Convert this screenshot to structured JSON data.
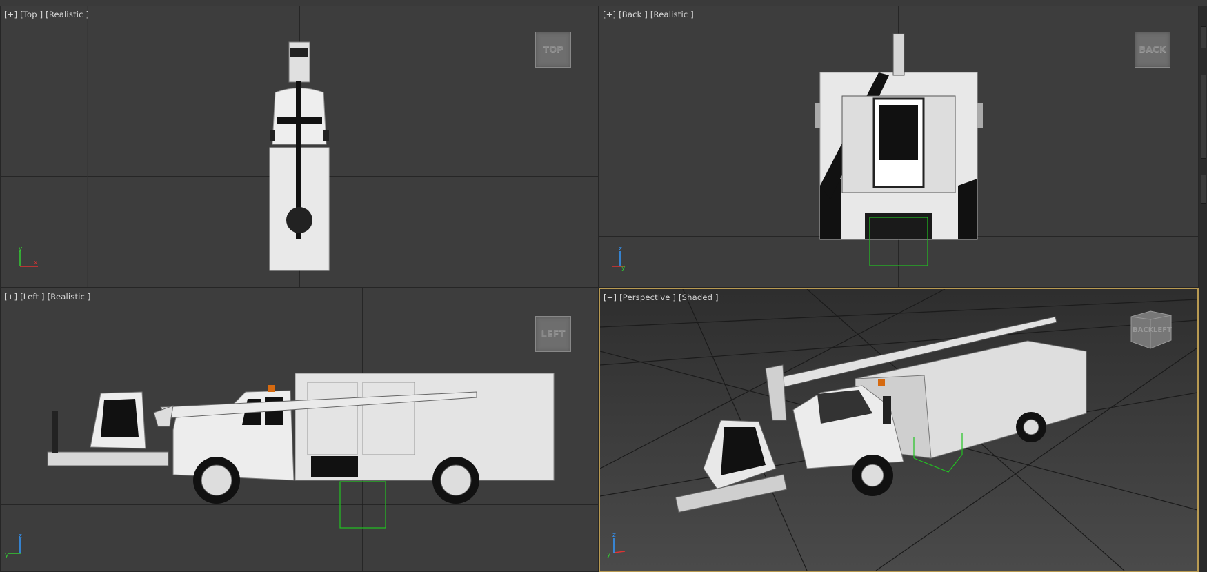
{
  "viewports": {
    "top": {
      "label": "[+] [Top ] [Realistic ]",
      "cube": "TOP"
    },
    "back": {
      "label": "[+] [Back ] [Realistic ]",
      "cube": "BACK"
    },
    "left": {
      "label": "[+] [Left ] [Realistic ]",
      "cube": "LEFT"
    },
    "perspective": {
      "label": "[+] [Perspective ] [Shaded ]",
      "cube_faces": [
        "BACK",
        "LEFT"
      ]
    }
  },
  "axes": {
    "x": "x",
    "y": "y",
    "z": "z"
  },
  "colors": {
    "viewport_bg": "#3d3d3d",
    "active_border": "#b89a52",
    "selection_box": "#22c322",
    "grid_line": "#202020",
    "model": "#e6e6e6"
  }
}
